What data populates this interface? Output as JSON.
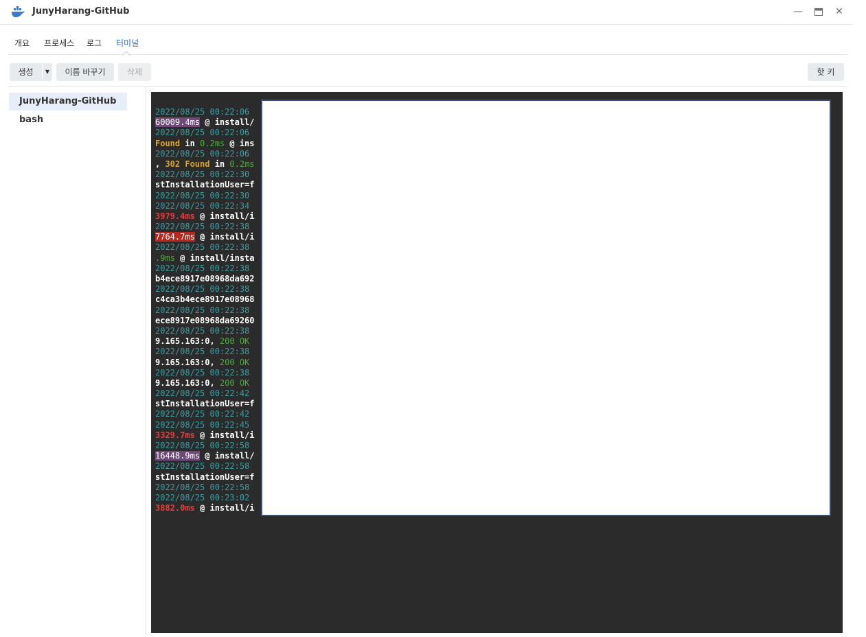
{
  "window": {
    "title": "JunyHarang-GitHub",
    "controls": [
      "minimize-icon",
      "maximize-icon",
      "close-icon"
    ]
  },
  "tabs": [
    {
      "label": "개요",
      "active": false
    },
    {
      "label": "프로세스",
      "active": false
    },
    {
      "label": "로그",
      "active": false
    },
    {
      "label": "터미널",
      "active": true
    }
  ],
  "toolbar": {
    "create_label": "생성",
    "rename_label": "이름 바꾸기",
    "delete_label": "삭제",
    "hotkey_label": "핫 키"
  },
  "sidebar": {
    "items": [
      {
        "label": "JunyHarang-GitHub",
        "selected": true
      },
      {
        "label": "bash",
        "selected": false
      }
    ]
  },
  "terminal": {
    "lines": [
      [
        {
          "t": "2022/08/25 00:22:06",
          "c": "ts"
        }
      ],
      [
        {
          "t": "60009.4ms",
          "c": "seg-hl-purple"
        },
        {
          "t": " @ install/",
          "c": "seg-w"
        }
      ],
      [
        {
          "t": "2022/08/25 00:22:06",
          "c": "ts"
        }
      ],
      [
        {
          "t": "Found",
          "c": "seg-y"
        },
        {
          "t": " in ",
          "c": "seg-w"
        },
        {
          "t": "0.2ms",
          "c": "seg-g"
        },
        {
          "t": " @ ins",
          "c": "seg-w"
        }
      ],
      [
        {
          "t": "2022/08/25 00:22:06",
          "c": "ts"
        }
      ],
      [
        {
          "t": ", ",
          "c": "seg-w"
        },
        {
          "t": "302 Found",
          "c": "seg-y"
        },
        {
          "t": " in ",
          "c": "seg-w"
        },
        {
          "t": "0.2ms",
          "c": "seg-g"
        }
      ],
      [
        {
          "t": "2022/08/25 00:22:30",
          "c": "ts"
        }
      ],
      [
        {
          "t": "stInstallationUser=f",
          "c": "seg-w"
        }
      ],
      [
        {
          "t": "2022/08/25 00:22:30",
          "c": "ts"
        }
      ],
      [
        {
          "t": "2022/08/25 00:22:34",
          "c": "ts"
        }
      ],
      [
        {
          "t": "3979.4ms",
          "c": "seg-r"
        },
        {
          "t": " @ install/i",
          "c": "seg-w"
        }
      ],
      [
        {
          "t": "2022/08/25 00:22:38",
          "c": "ts"
        }
      ],
      [
        {
          "t": "7764.7ms",
          "c": "seg-hl-red"
        },
        {
          "t": " @ install/i",
          "c": "seg-w"
        }
      ],
      [
        {
          "t": "2022/08/25 00:22:38",
          "c": "ts"
        }
      ],
      [
        {
          "t": ".9ms",
          "c": "seg-g"
        },
        {
          "t": " @ install/insta",
          "c": "seg-w"
        }
      ],
      [
        {
          "t": "2022/08/25 00:22:38",
          "c": "ts"
        }
      ],
      [
        {
          "t": "b4ece8917e08968da692",
          "c": "seg-w"
        }
      ],
      [
        {
          "t": "2022/08/25 00:22:38",
          "c": "ts"
        }
      ],
      [
        {
          "t": "c4ca3b4ece8917e08968",
          "c": "seg-w"
        }
      ],
      [
        {
          "t": "2022/08/25 00:22:38",
          "c": "ts"
        }
      ],
      [
        {
          "t": "ece8917e08968da69260",
          "c": "seg-w"
        }
      ],
      [
        {
          "t": "2022/08/25 00:22:38",
          "c": "ts"
        }
      ],
      [
        {
          "t": "9.165.163:0, ",
          "c": "seg-w"
        },
        {
          "t": "200 OK",
          "c": "seg-g"
        }
      ],
      [
        {
          "t": "2022/08/25 00:22:38",
          "c": "ts"
        }
      ],
      [
        {
          "t": "9.165.163:0, ",
          "c": "seg-w"
        },
        {
          "t": "200 OK",
          "c": "seg-g"
        }
      ],
      [
        {
          "t": "2022/08/25 00:22:38",
          "c": "ts"
        }
      ],
      [
        {
          "t": "9.165.163:0, ",
          "c": "seg-w"
        },
        {
          "t": "200 OK",
          "c": "seg-g"
        }
      ],
      [
        {
          "t": "2022/08/25 00:22:42",
          "c": "ts"
        }
      ],
      [
        {
          "t": "stInstallationUser=f",
          "c": "seg-w"
        }
      ],
      [
        {
          "t": "2022/08/25 00:22:42",
          "c": "ts"
        }
      ],
      [
        {
          "t": "2022/08/25 00:22:45",
          "c": "ts"
        }
      ],
      [
        {
          "t": "3329.7ms",
          "c": "seg-r"
        },
        {
          "t": " @ install/i",
          "c": "seg-w"
        }
      ],
      [
        {
          "t": "2022/08/25 00:22:58",
          "c": "ts"
        }
      ],
      [
        {
          "t": "16448.9ms",
          "c": "seg-hl-purple"
        },
        {
          "t": " @ install/",
          "c": "seg-w"
        }
      ],
      [
        {
          "t": "2022/08/25 00:22:58",
          "c": "ts"
        }
      ],
      [
        {
          "t": "stInstallationUser=f",
          "c": "seg-w"
        }
      ],
      [
        {
          "t": "2022/08/25 00:22:58",
          "c": "ts"
        }
      ],
      [
        {
          "t": "2022/08/25 00:23:02",
          "c": "ts"
        }
      ],
      [
        {
          "t": "3882.0ms",
          "c": "seg-r"
        },
        {
          "t": " @ install/i",
          "c": "seg-w"
        }
      ]
    ]
  }
}
